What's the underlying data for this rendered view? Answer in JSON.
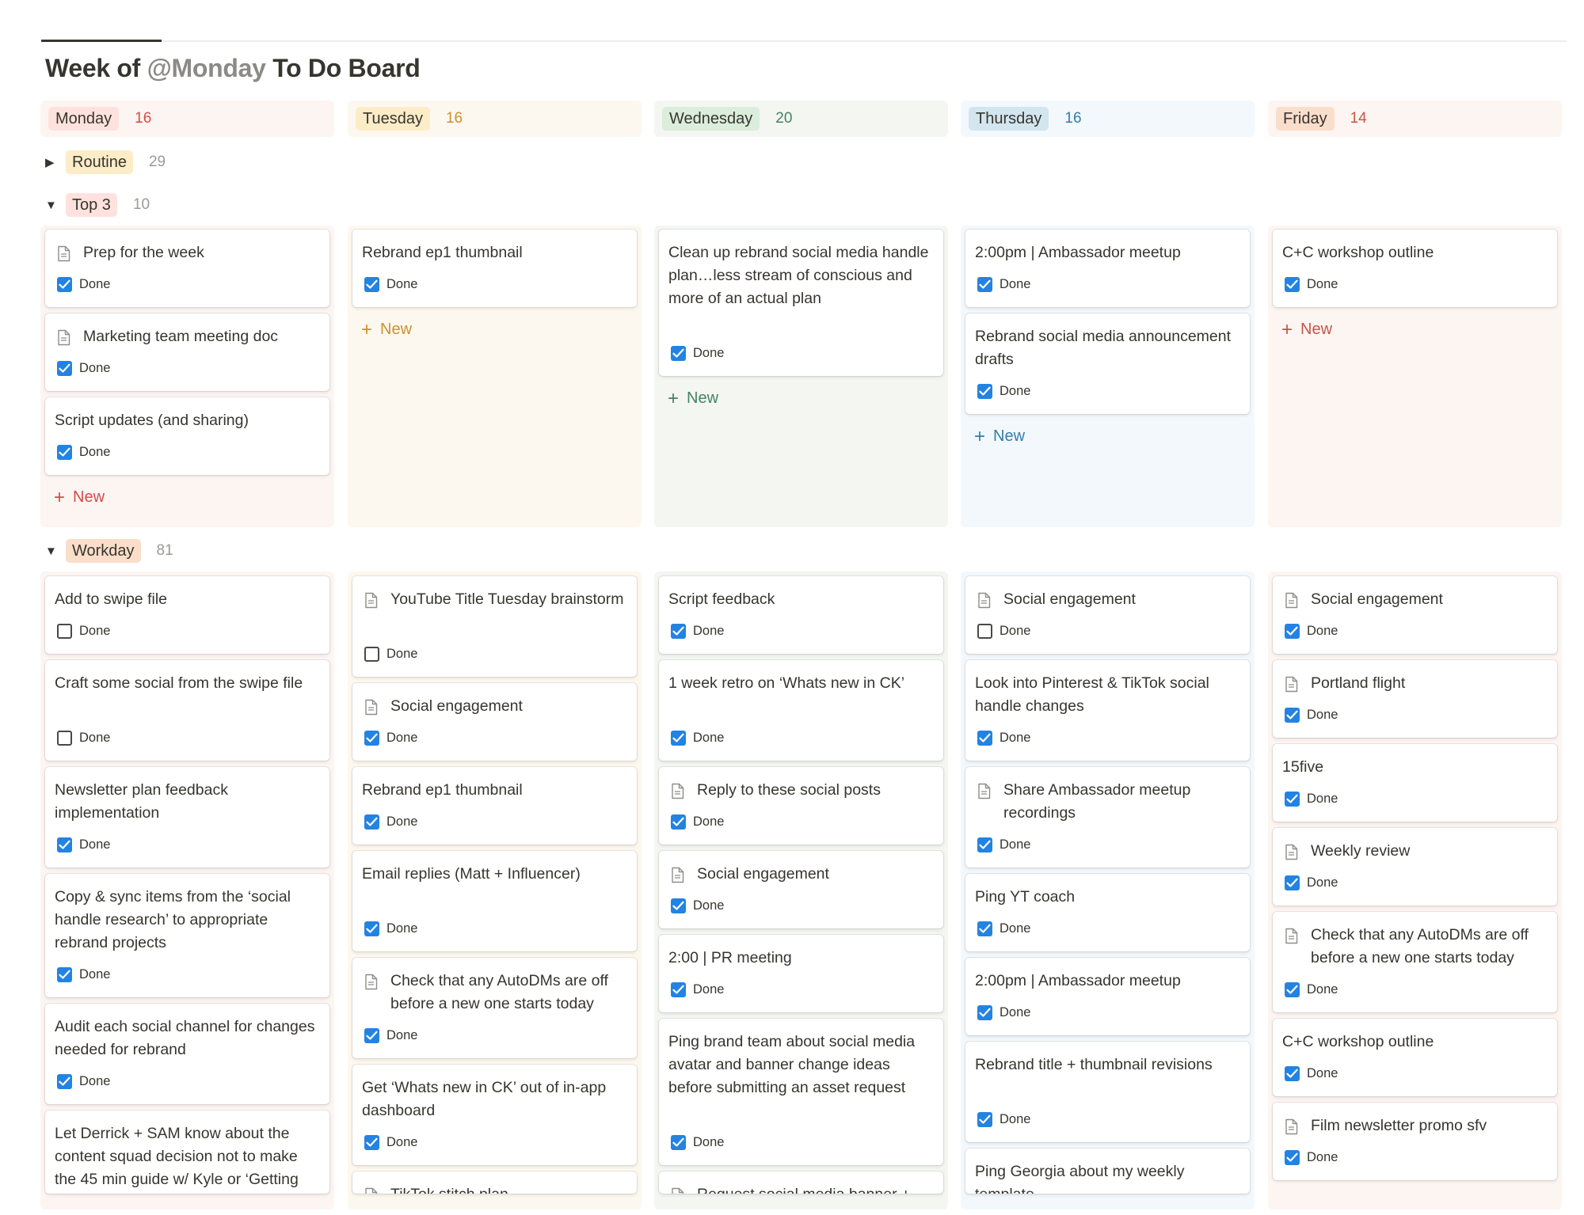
{
  "page": {
    "title_prefix": "Week of ",
    "title_mention": "@Monday",
    "title_suffix": " To Do Board"
  },
  "colors": {
    "monday_bg": "#fdf5f2",
    "monday_tag": "#ffe2dd",
    "monday_accent": "#d44c47",
    "tuesday_bg": "#fdf8ef",
    "tuesday_tag": "#fdecc8",
    "tuesday_accent": "#cb912f",
    "wednesday_bg": "#f4f6f2",
    "wednesday_tag": "#dbeddb",
    "wednesday_accent": "#448361",
    "thursday_bg": "#f3f8fc",
    "thursday_tag": "#d3e5ef",
    "thursday_accent": "#337ea9",
    "friday_bg": "#fdf5f1",
    "friday_tag": "#fadecc",
    "friday_accent": "#c4554d",
    "checkbox_blue": "#2383e2"
  },
  "columns": [
    {
      "label": "Monday",
      "count": "16"
    },
    {
      "label": "Tuesday",
      "count": "16"
    },
    {
      "label": "Wednesday",
      "count": "20"
    },
    {
      "label": "Thursday",
      "count": "16"
    },
    {
      "label": "Friday",
      "count": "14"
    }
  ],
  "groups": {
    "routine": {
      "label": "Routine",
      "count": "29",
      "state": "collapsed",
      "color": "#fdecc8"
    },
    "top3": {
      "label": "Top 3",
      "count": "10",
      "state": "expanded",
      "color": "#ffe2dd"
    },
    "workday": {
      "label": "Workday",
      "count": "81",
      "state": "expanded",
      "color": "#fadec9"
    }
  },
  "new_label": "New",
  "done_label": "Done",
  "top3": [
    [
      {
        "title": "Prep for the week",
        "icon": "page-icon",
        "done": true
      },
      {
        "title": "Marketing team meeting doc",
        "icon": "page-icon",
        "done": true
      },
      {
        "title": "Script updates (and sharing)",
        "icon": "",
        "done": true
      }
    ],
    [
      {
        "title": "Rebrand ep1 thumbnail",
        "icon": "",
        "done": true
      }
    ],
    [
      {
        "title": "Clean up rebrand social media handle plan…less stream of conscious and more of an actual plan",
        "icon": "",
        "done": true
      }
    ],
    [
      {
        "title": "2:00pm | Ambassador meetup",
        "icon": "",
        "done": true
      },
      {
        "title": "Rebrand social media announcement drafts",
        "icon": "",
        "done": true
      }
    ],
    [
      {
        "title": "C+C workshop outline",
        "icon": "",
        "done": true
      }
    ]
  ],
  "workday": [
    [
      {
        "title": "Add to swipe file",
        "icon": "",
        "done": false
      },
      {
        "title": "Craft some social from the swipe file",
        "icon": "",
        "done": false
      },
      {
        "title": "Newsletter plan feedback implementation",
        "icon": "",
        "done": true
      },
      {
        "title": "Copy & sync items from the ‘social handle research’ to appropriate rebrand projects",
        "icon": "",
        "done": true
      },
      {
        "title": "Audit each social channel for changes needed for rebrand",
        "icon": "",
        "done": true
      },
      {
        "title": "Let Derrick + SAM know about the content squad decision not to make the 45 min guide w/ Kyle or ‘Getting",
        "icon": "",
        "done": null
      }
    ],
    [
      {
        "title": "YouTube Title Tuesday brainstorm",
        "icon": "page-icon",
        "done": false
      },
      {
        "title": "Social engagement",
        "icon": "page-icon",
        "done": true
      },
      {
        "title": "Rebrand ep1 thumbnail",
        "icon": "",
        "done": true
      },
      {
        "title": "Email replies (Matt + Influencer)",
        "icon": "",
        "done": true
      },
      {
        "title": "Check that any AutoDMs are off before a new one starts today",
        "icon": "page-icon",
        "done": true
      },
      {
        "title": "Get ‘Whats new in CK’ out of in-app dashboard",
        "icon": "",
        "done": true
      },
      {
        "title": "TikTok stitch plan",
        "icon": "page-icon",
        "done": null
      }
    ],
    [
      {
        "title": "Script feedback",
        "icon": "",
        "done": true
      },
      {
        "title": "1 week retro on ‘Whats new in CK’",
        "icon": "",
        "done": true
      },
      {
        "title": "Reply to these social posts",
        "icon": "page-icon",
        "done": true
      },
      {
        "title": "Social engagement",
        "icon": "page-icon",
        "done": true
      },
      {
        "title": "2:00 | PR meeting",
        "icon": "",
        "done": true
      },
      {
        "title": "Ping brand team about social media avatar and banner change ideas before submitting an asset request",
        "icon": "",
        "done": true
      },
      {
        "title": "Request social media banner + profile photo assets for rebrand",
        "icon": "page-icon",
        "done": null
      }
    ],
    [
      {
        "title": "Social engagement",
        "icon": "page-icon",
        "done": false
      },
      {
        "title": "Look into Pinterest & TikTok social handle changes",
        "icon": "",
        "done": true
      },
      {
        "title": "Share Ambassador meetup recordings",
        "icon": "page-icon",
        "done": true
      },
      {
        "title": "Ping YT coach",
        "icon": "",
        "done": true
      },
      {
        "title": "2:00pm | Ambassador meetup",
        "icon": "",
        "done": true
      },
      {
        "title": "Rebrand title + thumbnail revisions",
        "icon": "",
        "done": true
      },
      {
        "title": "Ping Georgia about my weekly template",
        "icon": "",
        "done": null
      }
    ],
    [
      {
        "title": "Social engagement",
        "icon": "page-icon",
        "done": true
      },
      {
        "title": "Portland flight",
        "icon": "page-icon",
        "done": true
      },
      {
        "title": "15five",
        "icon": "",
        "done": true
      },
      {
        "title": "Weekly review",
        "icon": "page-icon",
        "done": true
      },
      {
        "title": "Check that any AutoDMs are off before a new one starts today",
        "icon": "page-icon",
        "done": true
      },
      {
        "title": "C+C workshop outline",
        "icon": "",
        "done": true
      },
      {
        "title": "Film newsletter promo sfv",
        "icon": "page-icon",
        "done": true
      }
    ]
  ]
}
